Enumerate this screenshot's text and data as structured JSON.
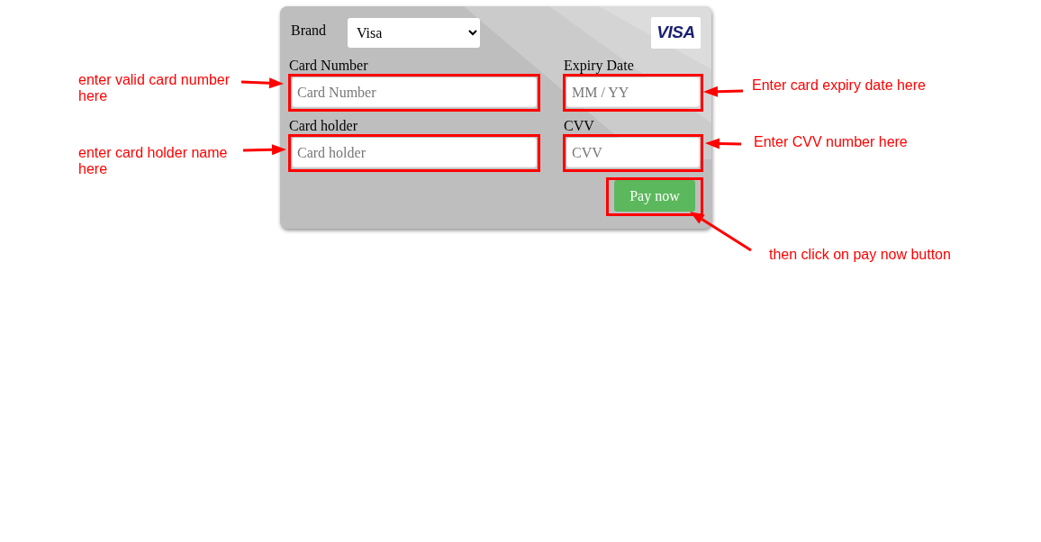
{
  "card": {
    "brand_label": "Brand",
    "brand_select": {
      "value": "Visa"
    },
    "logo": "VISA",
    "fields": [
      {
        "label": "Card Number",
        "placeholder": "Card Number",
        "highlighted": true
      },
      {
        "label": "Expiry Date",
        "placeholder": "MM / YY",
        "highlighted": true
      },
      {
        "label": "Card holder",
        "placeholder": "Card holder",
        "highlighted": true
      },
      {
        "label": "CVV",
        "placeholder": "CVV",
        "highlighted": true
      }
    ],
    "button": {
      "label": "Pay now",
      "highlighted": true
    }
  },
  "annotations": [
    {
      "text": "enter valid card number here"
    },
    {
      "text": "enter card holder name here"
    },
    {
      "text": "Enter card expiry date here"
    },
    {
      "text": "Enter CVV number here"
    },
    {
      "text": "then click on pay now button"
    }
  ]
}
